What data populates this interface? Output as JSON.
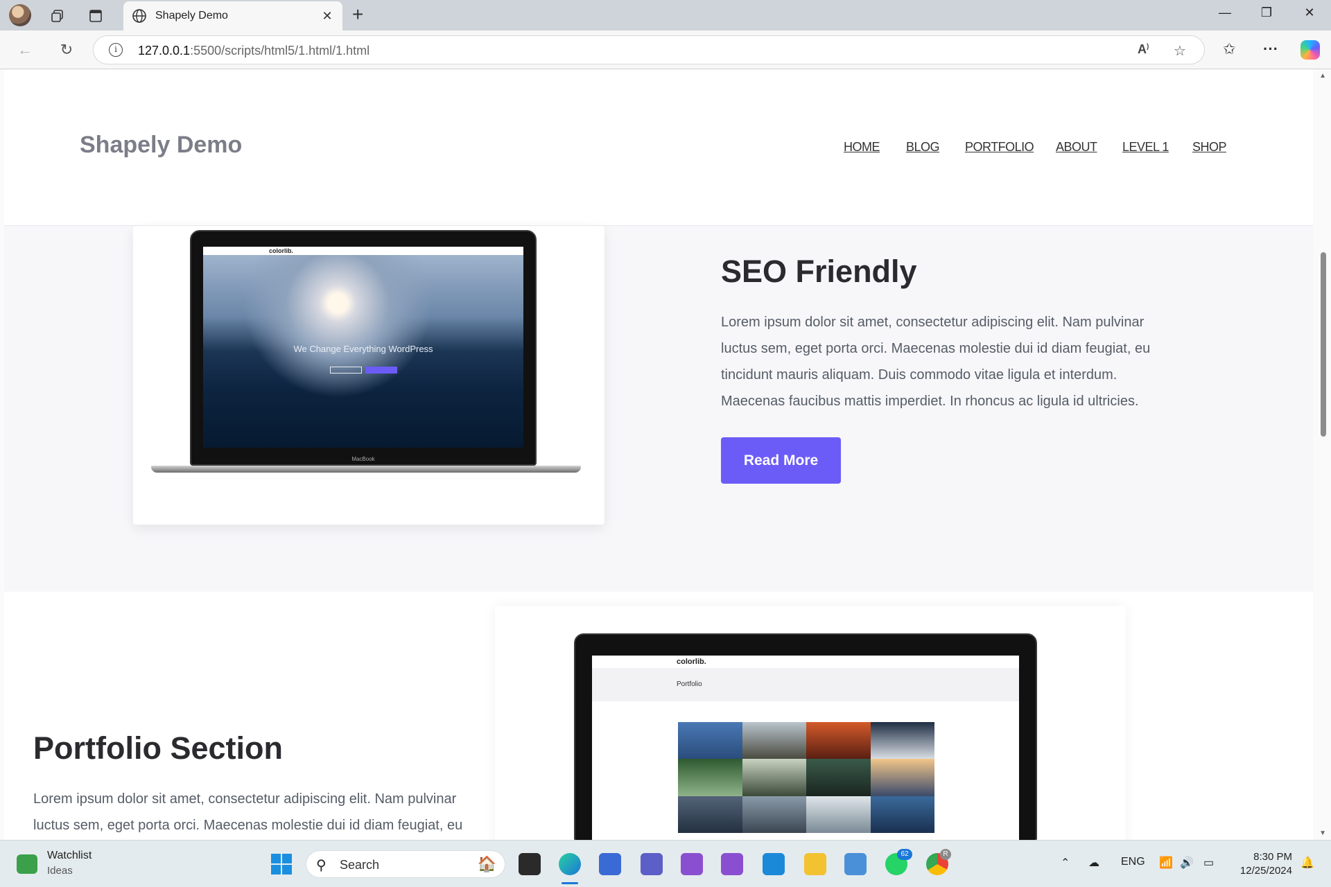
{
  "browser": {
    "tab_title": "Shapely Demo",
    "url_host": "127.0.0.1",
    "url_path": ":5500/scripts/html5/1.html/1.html"
  },
  "site": {
    "brand": "Shapely Demo",
    "menu": [
      "HOME",
      "BLOG",
      "PORTFOLIO",
      "ABOUT",
      "LEVEL 1",
      "SHOP"
    ],
    "seo": {
      "heading": "SEO Friendly",
      "paragraph_lines": [
        "Lorem ipsum dolor sit amet, consectetur adipiscing elit. Nam pulvinar",
        "luctus sem, eget porta orci. Maecenas molestie dui id diam feugiat, eu",
        "tincidunt mauris aliquam. Duis commodo vitae ligula et interdum.",
        "Maecenas faucibus mattis imperdiet. In rhoncus ac ligula id ultricies."
      ],
      "button": "Read More",
      "mockup_brand": "colorlib.",
      "mockup_hero_text": "We Change Everything WordPress",
      "mockup_base_label": "MacBook"
    },
    "portfolio": {
      "heading": "Portfolio Section",
      "paragraph_lines": [
        "Lorem ipsum dolor sit amet, consectetur adipiscing elit. Nam pulvinar",
        "luctus sem, eget porta orci. Maecenas molestie dui id diam feugiat, eu"
      ],
      "mockup_brand": "colorlib.",
      "mockup_page_title": "Portfolio"
    }
  },
  "taskbar": {
    "widget_title": "Watchlist",
    "widget_subtitle": "Ideas",
    "search_placeholder": "Search",
    "language": "ENG",
    "time": "8:30 PM",
    "date": "12/25/2024",
    "whatsapp_badge": "62",
    "chrome_badge": "R"
  },
  "colors": {
    "accent_button": "#6c5cf7",
    "brand_text": "#7b7e88"
  }
}
